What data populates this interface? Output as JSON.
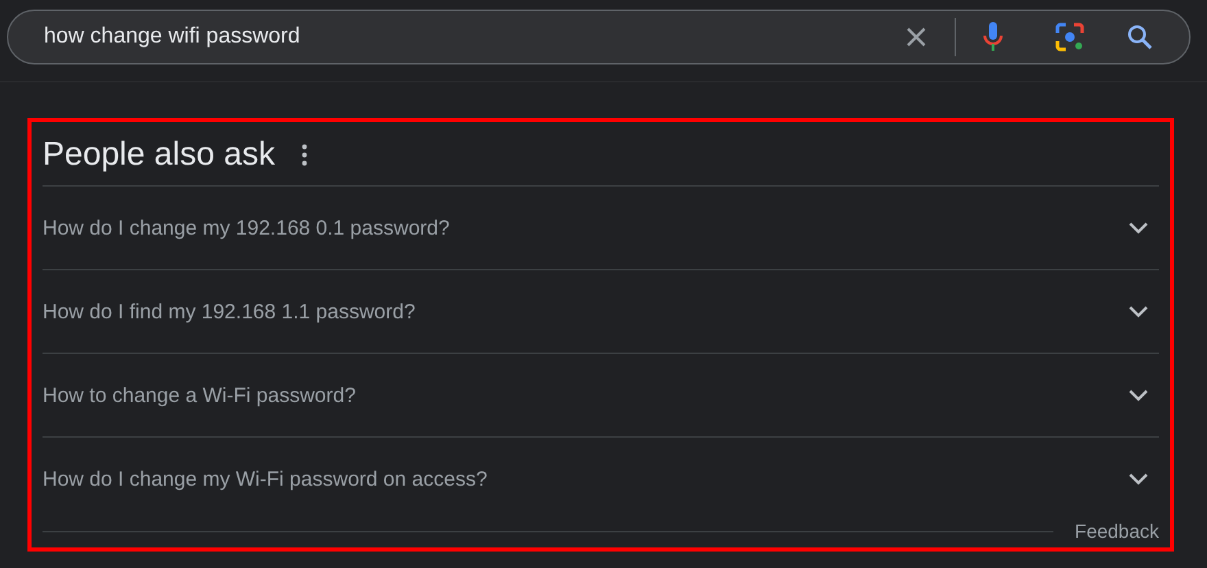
{
  "search": {
    "value": "how change wifi password"
  },
  "panel": {
    "title": "People also ask",
    "questions": [
      {
        "text": "How do I change my 192.168 0.1 password?",
        "expanded": false
      },
      {
        "text": "How do I find my 192.168 1.1 password?",
        "expanded": false
      },
      {
        "text": "How to change a Wi-Fi password?",
        "expanded": false
      },
      {
        "text": "How do I change my Wi-Fi password on access?",
        "expanded": false
      }
    ],
    "feedback": "Feedback"
  }
}
